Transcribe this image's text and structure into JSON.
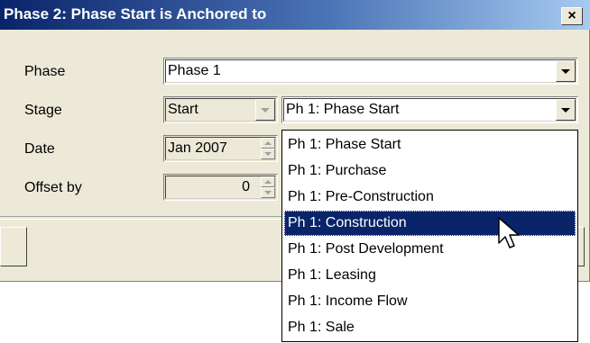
{
  "dialog": {
    "title": "Phase 2: Phase Start is Anchored to",
    "close_label": "×"
  },
  "form": {
    "phase": {
      "label": "Phase",
      "value": "Phase 1"
    },
    "stage": {
      "label": "Stage",
      "value": "Start",
      "anchor_value": "Ph 1: Phase Start"
    },
    "date": {
      "label": "Date",
      "value": "Jan 2007"
    },
    "offset": {
      "label": "Offset by",
      "value": "0"
    }
  },
  "dropdown": {
    "selected_index": 3,
    "items": [
      "Ph 1: Phase Start",
      "Ph 1: Purchase",
      "Ph 1: Pre-Construction",
      "Ph 1: Construction",
      "Ph 1: Post Development",
      "Ph 1: Leasing",
      "Ph 1: Income Flow",
      "Ph 1: Sale"
    ]
  }
}
